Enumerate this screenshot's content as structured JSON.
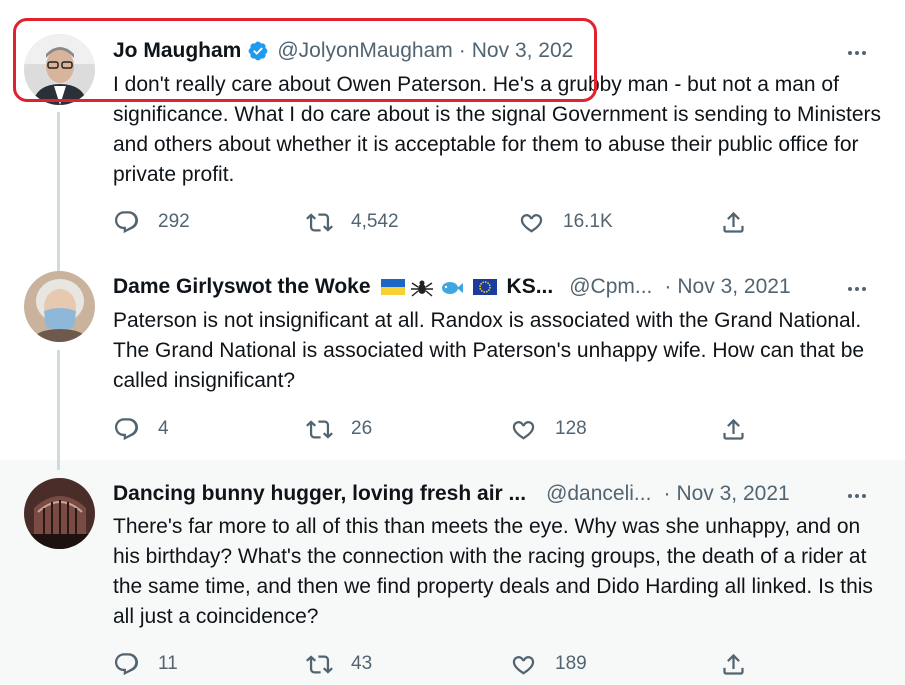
{
  "tweets": [
    {
      "name": "Jo Maugham",
      "handle": "@JolyonMaugham",
      "date": "Nov 3, 202",
      "text": "I don't really care about Owen Paterson. He's a grubby man - but not a man of significance. What I do care about is the signal Government is sending to Ministers and others about whether it is acceptable for them to abuse their public office for private profit.",
      "replies": "292",
      "retweets": "4,542",
      "likes": "16.1K"
    },
    {
      "name": "Dame Girlyswot the Woke",
      "name_suffix": "KS...",
      "handle": "@Cpm...",
      "date": "Nov 3, 2021",
      "text": "Paterson is not insignificant at all. Randox is associated with the Grand National. The Grand National is associated with Paterson's unhappy wife. How can that be called insignificant?",
      "replies": "4",
      "retweets": "26",
      "likes": "128",
      "emojis": [
        "flag-ukraine-icon",
        "spider-icon",
        "fish-icon",
        "flag-eu-icon"
      ]
    },
    {
      "name": "Dancing bunny hugger, loving fresh air ...",
      "handle": "@danceli...",
      "date": "Nov 3, 2021",
      "text": "There's far more to all of this than meets the eye. Why was she unhappy, and on his birthday? What's the connection with the racing groups, the death of a rider at the same time, and then we find property deals and Dido Harding all linked. Is this all just a coincidence?",
      "replies": "11",
      "retweets": "43",
      "likes": "189"
    }
  ],
  "colors": {
    "verified": "#1d9bf0",
    "muted": "#536471",
    "highlight_box": "#e0212f",
    "thread_line": "#cfd9de"
  }
}
